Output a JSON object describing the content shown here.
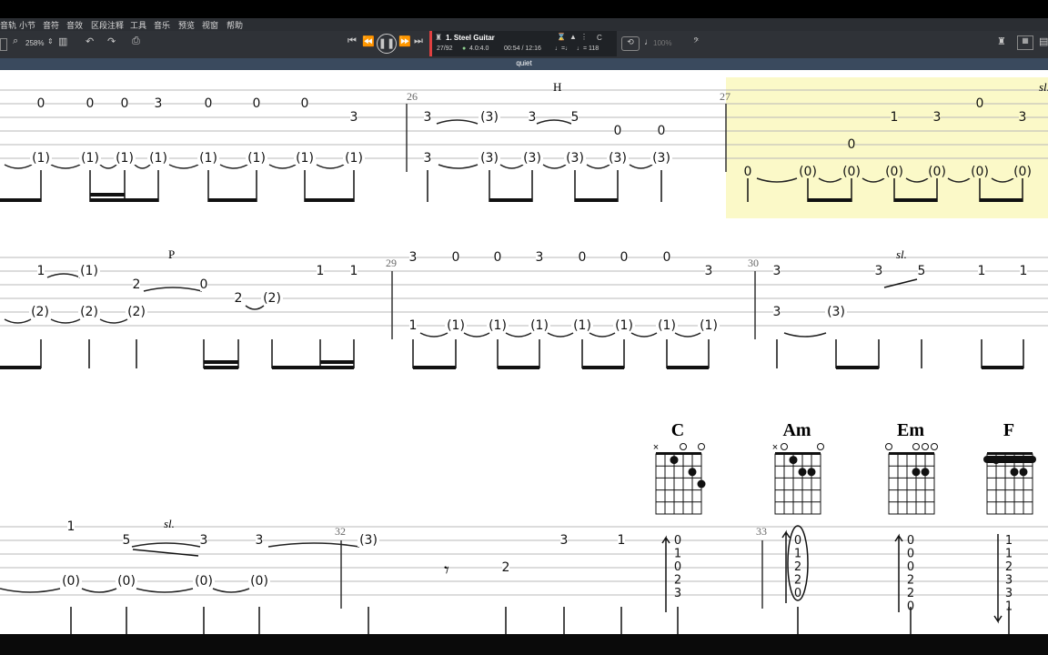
{
  "menu": [
    "音轨",
    "小节",
    "音符",
    "音效",
    "区段注释",
    "工具",
    "音乐",
    "预览",
    "视窗",
    "帮助"
  ],
  "toolbar": {
    "zoom": "258%",
    "track_name": "1. Steel Guitar",
    "bar_position": "27/92",
    "time_signature": "4.0:4.0",
    "time": "00:54 / 12:16",
    "key": "C",
    "tempo_icon": "♩=♩",
    "tempo": "♩= 118",
    "speed": "100%",
    "accent_color": "#e04040"
  },
  "title_section": "quiet",
  "score": {
    "bar_numbers": [
      "26",
      "27",
      "29",
      "30",
      "32",
      "33"
    ],
    "techniques": [
      "H",
      "P",
      "sl.",
      "sl.",
      "sl."
    ],
    "chords": [
      {
        "name": "C",
        "top": "× ○ ○"
      },
      {
        "name": "Am",
        "top": "×○ ○"
      },
      {
        "name": "Em",
        "top": "○ ○○○"
      },
      {
        "name": "F",
        "top": ""
      }
    ],
    "highlight_color": "#fbf9c8"
  }
}
